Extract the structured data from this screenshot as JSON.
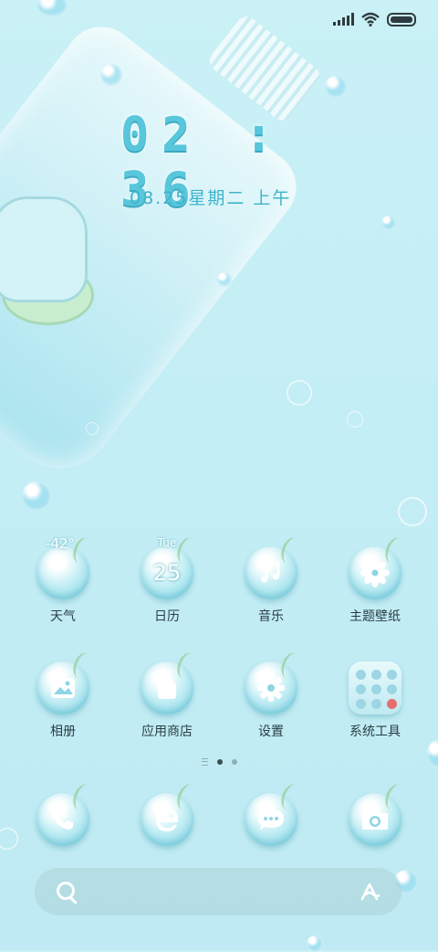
{
  "clock": {
    "time": "02 : 36",
    "date": "08.25星期二 上午"
  },
  "home": {
    "row1": [
      {
        "id": "weather",
        "label": "天气",
        "temp": "-42°"
      },
      {
        "id": "calendar",
        "label": "日历",
        "day": "Tue",
        "num": "25"
      },
      {
        "id": "music",
        "label": "音乐"
      },
      {
        "id": "themes",
        "label": "主题壁纸"
      }
    ],
    "row2": [
      {
        "id": "gallery",
        "label": "相册"
      },
      {
        "id": "appstore",
        "label": "应用商店"
      },
      {
        "id": "settings",
        "label": "设置"
      },
      {
        "id": "systools",
        "label": "系统工具"
      }
    ]
  },
  "dock": [
    {
      "id": "phone",
      "icon": "phone-icon"
    },
    {
      "id": "browser",
      "icon": "browser-icon"
    },
    {
      "id": "messages",
      "icon": "message-icon"
    },
    {
      "id": "camera",
      "icon": "camera-icon"
    }
  ],
  "pager": {
    "pages": 3,
    "active": 1
  },
  "colors": {
    "accent": "#58c6db",
    "background": "#c9f1f6"
  }
}
